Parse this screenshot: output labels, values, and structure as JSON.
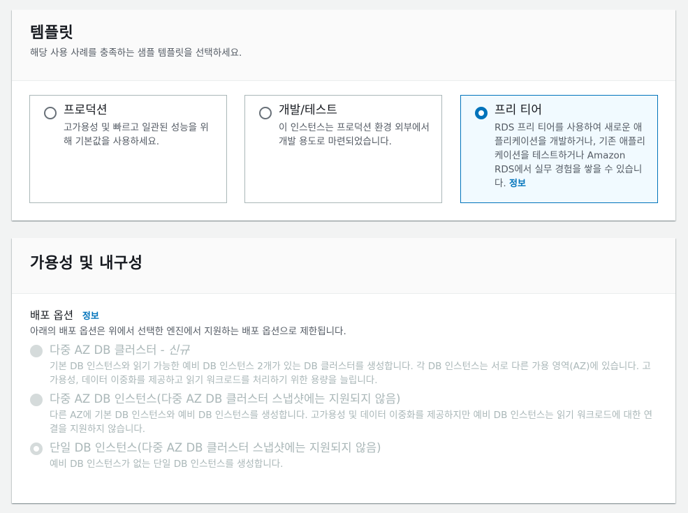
{
  "template_section": {
    "title": "템플릿",
    "description": "해당 사용 사례를 충족하는 샘플 템플릿을 선택하세요.",
    "tiles": [
      {
        "label": "프로덕션",
        "description": "고가용성 및 빠르고 일관된 성능을 위해 기본값을 사용하세요.",
        "selected": false
      },
      {
        "label": "개발/테스트",
        "description": "이 인스턴스는 프로덕션 환경 외부에서 개발 용도로 마련되었습니다.",
        "selected": false
      },
      {
        "label": "프리 티어",
        "description": "RDS 프리 티어를 사용하여 새로운 애플리케이션을 개발하거나, 기존 애플리케이션을 테스트하거나 Amazon RDS에서 실무 경험을 쌓을 수 있습니다.",
        "info_link": "정보",
        "selected": true
      }
    ]
  },
  "availability_section": {
    "title": "가용성 및 내구성",
    "deployment": {
      "label": "배포 옵션",
      "info_link": "정보",
      "description": "아래의 배포 옵션은 위에서 선택한 엔진에서 지원하는 배포 옵션으로 제한됩니다.",
      "options": [
        {
          "title": "다중 AZ DB 클러스터 - ",
          "tag": "신규",
          "description": "기본 DB 인스턴스와 읽기 가능한 예비 DB 인스턴스 2개가 있는 DB 클러스터를 생성합니다. 각 DB 인스턴스는 서로 다른 가용 영역(AZ)에 있습니다. 고가용성, 데이터 이중화를 제공하고 읽기 워크로드를 처리하기 위한 용량을 늘립니다.",
          "selected": false
        },
        {
          "title": "다중 AZ DB 인스턴스(다중 AZ DB 클러스터 스냅샷에는 지원되지 않음)",
          "tag": "",
          "description": "다른 AZ에 기본 DB 인스턴스와 예비 DB 인스턴스를 생성합니다. 고가용성 및 데이터 이중화를 제공하지만 예비 DB 인스턴스는 읽기 워크로드에 대한 연결을 지원하지 않습니다.",
          "selected": false
        },
        {
          "title": "단일 DB 인스턴스(다중 AZ DB 클러스터 스냅샷에는 지원되지 않음)",
          "tag": "",
          "description": "예비 DB 인스턴스가 없는 단일 DB 인스턴스를 생성합니다.",
          "selected": true
        }
      ]
    }
  }
}
